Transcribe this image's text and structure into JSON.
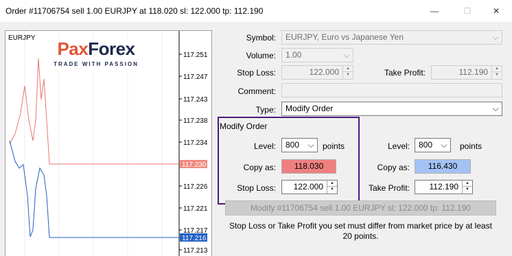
{
  "window": {
    "title": "Order #11706754 sell 1.00 EURJPY at 118.020 sl: 122.000 tp: 112.190",
    "minimize_glyph": "—",
    "maximize_glyph": "☐",
    "close_glyph": "✕"
  },
  "chart": {
    "symbol": "EURJPY",
    "logo": {
      "pax": "Pax",
      "forex": "Forex",
      "tagline": "TRADE WITH PASSION"
    },
    "price_ticks": [
      "117.251",
      "117.247",
      "117.243",
      "117.238",
      "117.234",
      "117.230",
      "117.226",
      "117.221",
      "117.217",
      "117.216",
      "117.213"
    ],
    "bid_label": "117.230",
    "ask_label": "117.216",
    "colors": {
      "bid": "#e8776e",
      "ask": "#1f5fbf",
      "bid_tag": "#f08a80",
      "ask_tag": "#2060c8"
    }
  },
  "form": {
    "symbol_label": "Symbol:",
    "symbol_value": "EURJPY, Euro vs Japanese Yen",
    "volume_label": "Volume:",
    "volume_value": "1.00",
    "stop_loss_label": "Stop Loss:",
    "stop_loss_value": "122.000",
    "take_profit_label": "Take Profit:",
    "take_profit_value": "112.190",
    "comment_label": "Comment:",
    "comment_value": "",
    "type_label": "Type:",
    "type_value": "Modify Order"
  },
  "modify": {
    "group_title": "Modify Order",
    "left": {
      "level_label": "Level:",
      "level_value": "800",
      "points_label": "points",
      "copy_label": "Copy as:",
      "copy_value": "118.030",
      "sl_label": "Stop Loss:",
      "sl_value": "122.000"
    },
    "right": {
      "level_label": "Level:",
      "level_value": "800",
      "points_label": "points",
      "copy_label": "Copy as:",
      "copy_value": "116.430",
      "tp_label": "Take Profit:",
      "tp_value": "112.190"
    },
    "button_label": "Modify #11706754 sell 1.00 EURJPY sl: 122.000 tp: 112.190",
    "note": "Stop Loss or Take Profit you set must differ from market price by at least 20 points."
  }
}
